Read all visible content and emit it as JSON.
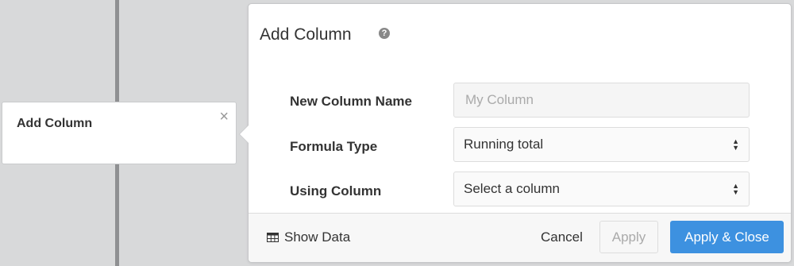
{
  "tooltip": {
    "title": "Add Column",
    "close_glyph": "×"
  },
  "panel": {
    "title": "Add Column",
    "help_glyph": "?",
    "fields": {
      "name": {
        "label": "New Column Name",
        "placeholder": "My Column",
        "value": ""
      },
      "formula": {
        "label": "Formula Type",
        "value": "Running total"
      },
      "using": {
        "label": "Using Column",
        "value": "Select a column"
      }
    },
    "footer": {
      "show_data": "Show Data",
      "cancel": "Cancel",
      "apply": "Apply",
      "apply_close": "Apply & Close"
    }
  },
  "icons": {
    "help": "question-circle-icon",
    "close": "close-icon",
    "table": "table-icon",
    "select_caret": "sort-caret-icon"
  },
  "colors": {
    "background": "#d8d9da",
    "divider": "#8f9092",
    "primary_button": "#3d91e0",
    "disabled_text": "#aaaaaa"
  }
}
